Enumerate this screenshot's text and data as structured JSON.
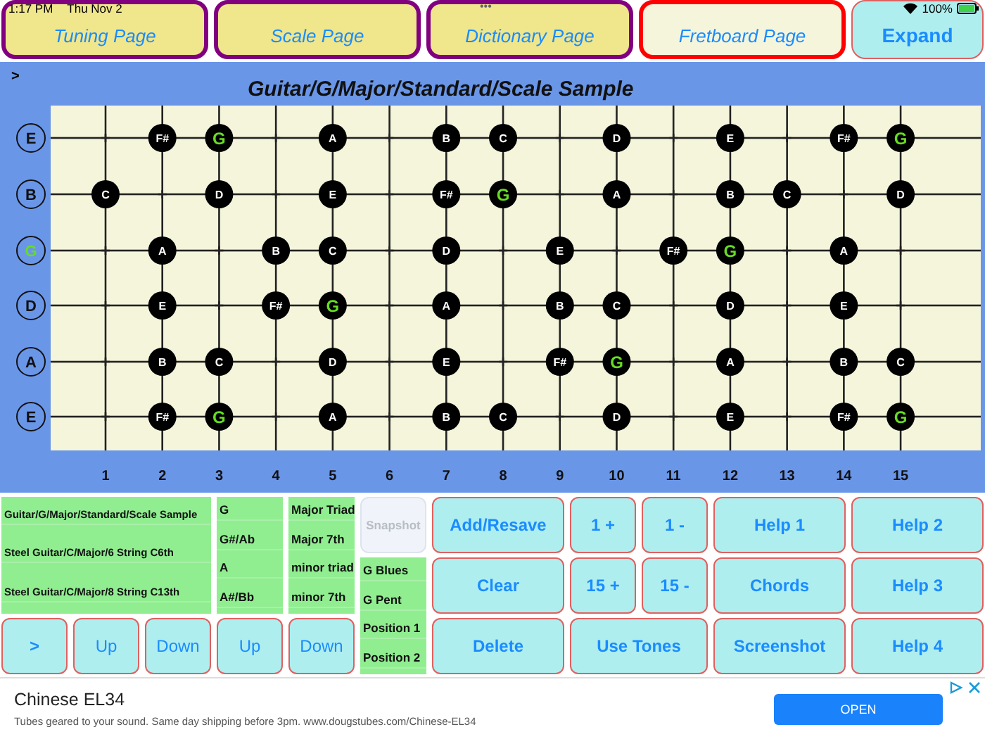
{
  "status_bar": {
    "time": "1:17 PM",
    "date": "Thu Nov 2",
    "dots": "•••",
    "battery": "100%"
  },
  "tabs": [
    {
      "label": "Tuning Page",
      "selected": false
    },
    {
      "label": "Scale Page",
      "selected": false
    },
    {
      "label": "Dictionary Page",
      "selected": false
    },
    {
      "label": "Fretboard Page",
      "selected": true
    }
  ],
  "expand_button": "Expand",
  "fretboard": {
    "toggle": ">",
    "title": "Guitar/G/Major/Standard/Scale Sample",
    "strings": [
      {
        "label": "E",
        "root": false,
        "frets": [
          {
            "dot": false
          },
          {
            "dot": true,
            "note": "F#",
            "root": false
          },
          {
            "dot": true,
            "note": "G",
            "root": true
          },
          {
            "dot": false
          },
          {
            "dot": true,
            "note": "A",
            "root": false
          },
          {
            "dot": false
          },
          {
            "dot": true,
            "note": "B",
            "root": false
          },
          {
            "dot": true,
            "note": "C",
            "root": false
          },
          {
            "dot": false
          },
          {
            "dot": true,
            "note": "D",
            "root": false
          },
          {
            "dot": false
          },
          {
            "dot": true,
            "note": "E",
            "root": false
          },
          {
            "dot": false
          },
          {
            "dot": true,
            "note": "F#",
            "root": false
          },
          {
            "dot": true,
            "note": "G",
            "root": true
          }
        ]
      },
      {
        "label": "B",
        "root": false,
        "frets": [
          {
            "dot": true,
            "note": "C",
            "root": false
          },
          {
            "dot": false
          },
          {
            "dot": true,
            "note": "D",
            "root": false
          },
          {
            "dot": false
          },
          {
            "dot": true,
            "note": "E",
            "root": false
          },
          {
            "dot": false
          },
          {
            "dot": true,
            "note": "F#",
            "root": false
          },
          {
            "dot": true,
            "note": "G",
            "root": true
          },
          {
            "dot": false
          },
          {
            "dot": true,
            "note": "A",
            "root": false
          },
          {
            "dot": false
          },
          {
            "dot": true,
            "note": "B",
            "root": false
          },
          {
            "dot": true,
            "note": "C",
            "root": false
          },
          {
            "dot": false
          },
          {
            "dot": true,
            "note": "D",
            "root": false
          }
        ]
      },
      {
        "label": "G",
        "root": true,
        "frets": [
          {
            "dot": false
          },
          {
            "dot": true,
            "note": "A",
            "root": false
          },
          {
            "dot": false
          },
          {
            "dot": true,
            "note": "B",
            "root": false
          },
          {
            "dot": true,
            "note": "C",
            "root": false
          },
          {
            "dot": false
          },
          {
            "dot": true,
            "note": "D",
            "root": false
          },
          {
            "dot": false
          },
          {
            "dot": true,
            "note": "E",
            "root": false
          },
          {
            "dot": false
          },
          {
            "dot": true,
            "note": "F#",
            "root": false
          },
          {
            "dot": true,
            "note": "G",
            "root": true
          },
          {
            "dot": false
          },
          {
            "dot": true,
            "note": "A",
            "root": false
          },
          {
            "dot": false
          }
        ]
      },
      {
        "label": "D",
        "root": false,
        "frets": [
          {
            "dot": false
          },
          {
            "dot": true,
            "note": "E",
            "root": false
          },
          {
            "dot": false
          },
          {
            "dot": true,
            "note": "F#",
            "root": false
          },
          {
            "dot": true,
            "note": "G",
            "root": true
          },
          {
            "dot": false
          },
          {
            "dot": true,
            "note": "A",
            "root": false
          },
          {
            "dot": false
          },
          {
            "dot": true,
            "note": "B",
            "root": false
          },
          {
            "dot": true,
            "note": "C",
            "root": false
          },
          {
            "dot": false
          },
          {
            "dot": true,
            "note": "D",
            "root": false
          },
          {
            "dot": false
          },
          {
            "dot": true,
            "note": "E",
            "root": false
          },
          {
            "dot": false
          }
        ]
      },
      {
        "label": "A",
        "root": false,
        "frets": [
          {
            "dot": false
          },
          {
            "dot": true,
            "note": "B",
            "root": false
          },
          {
            "dot": true,
            "note": "C",
            "root": false
          },
          {
            "dot": false
          },
          {
            "dot": true,
            "note": "D",
            "root": false
          },
          {
            "dot": false
          },
          {
            "dot": true,
            "note": "E",
            "root": false
          },
          {
            "dot": false
          },
          {
            "dot": true,
            "note": "F#",
            "root": false
          },
          {
            "dot": true,
            "note": "G",
            "root": true
          },
          {
            "dot": false
          },
          {
            "dot": true,
            "note": "A",
            "root": false
          },
          {
            "dot": false
          },
          {
            "dot": true,
            "note": "B",
            "root": false
          },
          {
            "dot": true,
            "note": "C",
            "root": false
          }
        ]
      },
      {
        "label": "E",
        "root": false,
        "frets": [
          {
            "dot": false
          },
          {
            "dot": true,
            "note": "F#",
            "root": false
          },
          {
            "dot": true,
            "note": "G",
            "root": true
          },
          {
            "dot": false
          },
          {
            "dot": true,
            "note": "A",
            "root": false
          },
          {
            "dot": false
          },
          {
            "dot": true,
            "note": "B",
            "root": false
          },
          {
            "dot": true,
            "note": "C",
            "root": false
          },
          {
            "dot": false
          },
          {
            "dot": true,
            "note": "D",
            "root": false
          },
          {
            "dot": false
          },
          {
            "dot": true,
            "note": "E",
            "root": false
          },
          {
            "dot": false
          },
          {
            "dot": true,
            "note": "F#",
            "root": false
          },
          {
            "dot": true,
            "note": "G",
            "root": true
          }
        ]
      }
    ],
    "fret_numbers": [
      "1",
      "2",
      "3",
      "4",
      "5",
      "6",
      "7",
      "8",
      "9",
      "10",
      "11",
      "12",
      "13",
      "14",
      "15"
    ]
  },
  "saved_list": [
    "Guitar/G/Major/Standard/Scale Sample",
    "Steel Guitar/C/Major/6 String C6th",
    "Steel Guitar/C/Major/8 String C13th"
  ],
  "key_list": [
    "G",
    "G#/Ab",
    "A",
    "A#/Bb"
  ],
  "chord_list": [
    "Major Triad",
    "Major 7th",
    "minor triad",
    "minor 7th"
  ],
  "nav_buttons": [
    ">",
    "Up",
    "Down",
    "Up",
    "Down"
  ],
  "snapshot": {
    "label": "Snapshot",
    "disabled": true
  },
  "scale_list": [
    "G Blues",
    "G Pent",
    "Position 1",
    "Position 2"
  ],
  "action_buttons": [
    "Add/Resave",
    "1 +",
    "1 -",
    "Help 1",
    "Help 2",
    "Clear",
    "15 +",
    "15 -",
    "Chords",
    "Help 3",
    "Delete",
    "Use Tones",
    "Screenshot",
    "Help 4"
  ],
  "ad": {
    "title": "Chinese EL34",
    "text": "Tubes geared to your sound. Same day shipping before 3pm. www.dougstubes.com/Chinese-EL34",
    "button": "OPEN"
  }
}
